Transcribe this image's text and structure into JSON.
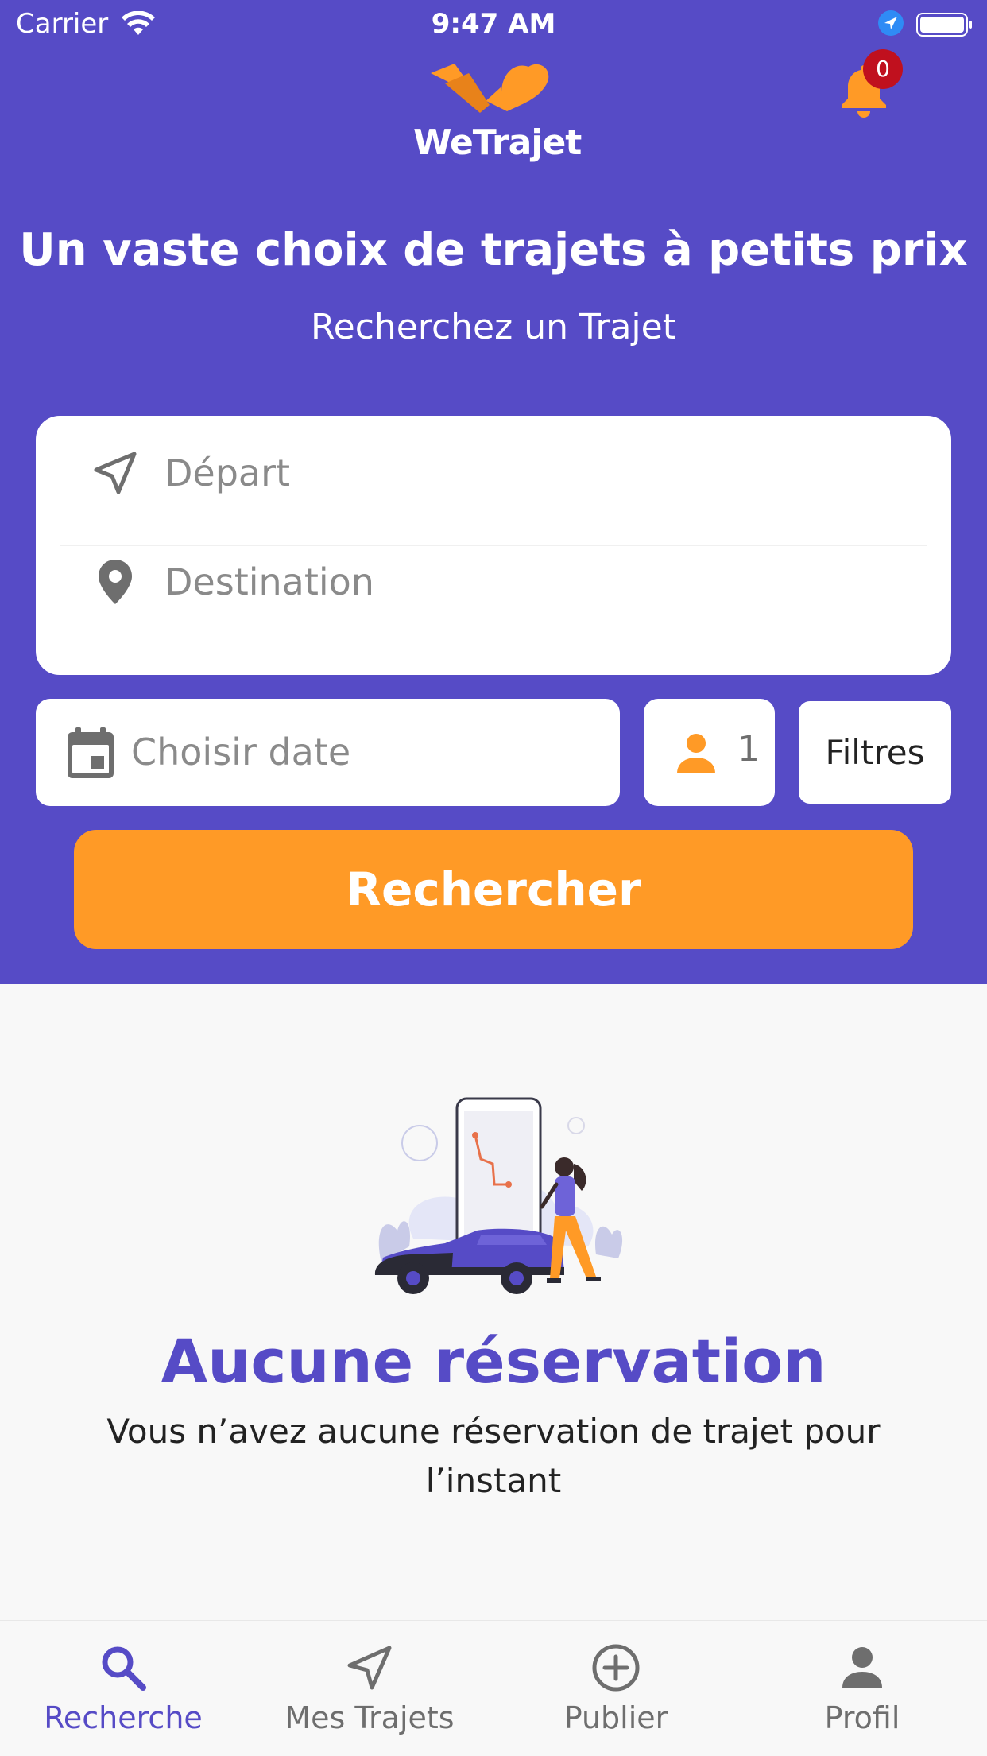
{
  "status_bar": {
    "carrier": "Carrier",
    "time": "9:47 AM"
  },
  "brand": {
    "name": "WeTrajet"
  },
  "notifications": {
    "count": "0"
  },
  "hero": {
    "title": "Un vaste choix de trajets à petits prix",
    "subtitle": "Recherchez un Trajet"
  },
  "search_form": {
    "depart_placeholder": "Départ",
    "destination_placeholder": "Destination",
    "date_placeholder": "Choisir date",
    "passengers": "1",
    "filters_label": "Filtres",
    "search_button": "Rechercher"
  },
  "empty_state": {
    "title": "Aucune réservation",
    "description": "Vous n’avez aucune réservation de trajet pour l’instant"
  },
  "bottom_nav": {
    "items": [
      {
        "label": "Recherche",
        "icon": "search-icon",
        "active": true
      },
      {
        "label": "Mes Trajets",
        "icon": "navigation-arrow-icon",
        "active": false
      },
      {
        "label": "Publier",
        "icon": "add-circle-icon",
        "active": false
      },
      {
        "label": "Profil",
        "icon": "person-icon",
        "active": false
      }
    ]
  },
  "colors": {
    "primary": "#564BC6",
    "accent": "#FF9A26",
    "badge": "#C0101E",
    "background": "#F8F8F8"
  }
}
